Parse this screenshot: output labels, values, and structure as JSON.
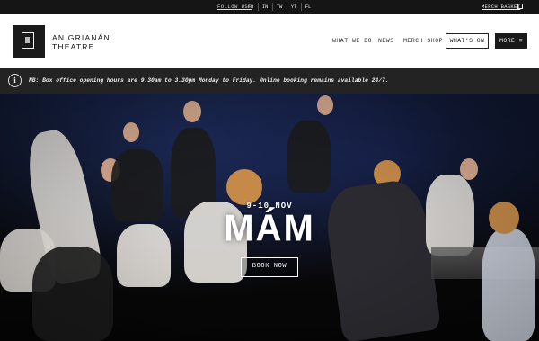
{
  "topbar": {
    "follow_label": "FOLLOW US:",
    "social": [
      "FB",
      "IN",
      "TW",
      "YT",
      "FL"
    ],
    "basket_label": "MERCH BASKET",
    "basket_icon": "basket-icon"
  },
  "header": {
    "logo_line1": "AN GRIANÁN",
    "logo_line2": "THEATRE",
    "nav": [
      "WHAT WE DO",
      "NEWS",
      "MERCH SHOP"
    ],
    "whats_on_label": "WHAT'S ON",
    "more_label": "MORE ≡"
  },
  "notice": {
    "icon": "info-icon",
    "text": "NB: Box office opening hours are 9.30am to 3.30pm Monday to Friday. Online booking remains available 24/7."
  },
  "hero": {
    "date": "9-10 NOV",
    "title": "MÁM",
    "button_label": "BOOK NOW"
  }
}
